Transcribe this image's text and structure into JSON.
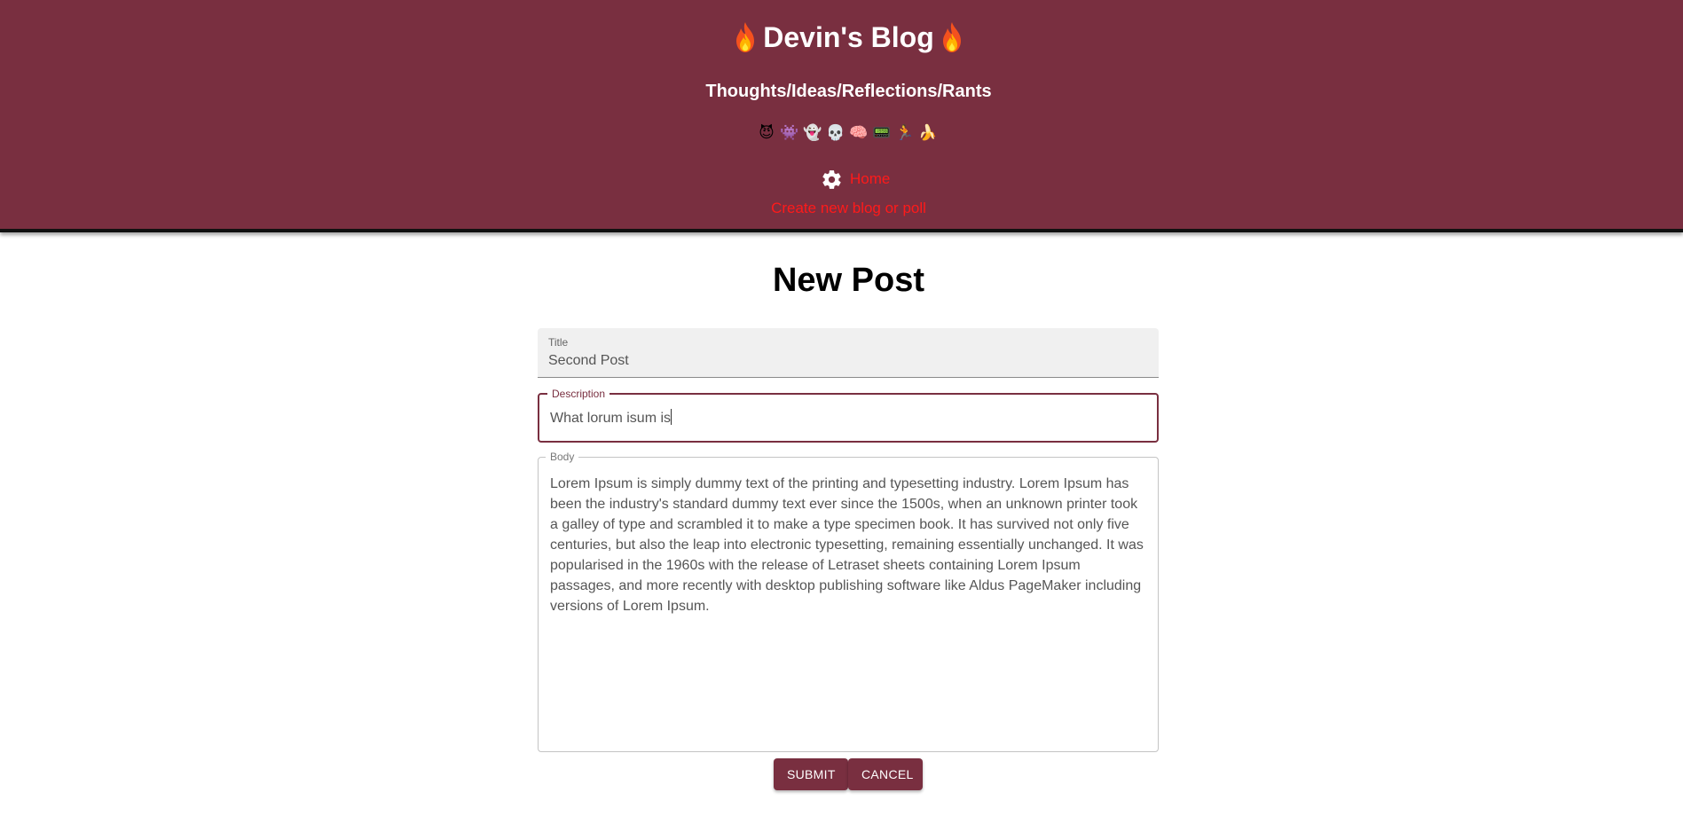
{
  "header": {
    "title": "Devin's Blog",
    "tagline": "Thoughts/Ideas/Reflections/Rants",
    "emojis": [
      "😈",
      "👾",
      "👻",
      "💀",
      "🧠",
      "📟",
      "🏃",
      "🍌"
    ],
    "nav": {
      "home_label": "Home",
      "create_label": "Create new blog or poll"
    }
  },
  "main": {
    "page_title": "New Post",
    "form": {
      "title_label": "Title",
      "title_value": "Second Post",
      "description_label": "Description",
      "description_value": "What lorum isum is",
      "body_label": "Body",
      "body_value": "Lorem Ipsum is simply dummy text of the printing and typesetting industry. Lorem Ipsum has been the industry's standard dummy text ever since the 1500s, when an unknown printer took a galley of type and scrambled it to make a type specimen book. It has survived not only five centuries, but also the leap into electronic typesetting, remaining essentially unchanged. It was popularised in the 1960s with the release of Letraset sheets containing Lorem Ipsum passages, and more recently with desktop publishing software like Aldus PageMaker including versions of Lorem Ipsum."
    },
    "buttons": {
      "submit_label": "SUBMIT",
      "cancel_label": "CANCEL"
    }
  },
  "colors": {
    "brand": "#792f40",
    "link": "#ff1a1a",
    "header_text": "#ffffff"
  },
  "icons": {
    "title_decoration": "fire-icon",
    "home": "gear-icon"
  }
}
